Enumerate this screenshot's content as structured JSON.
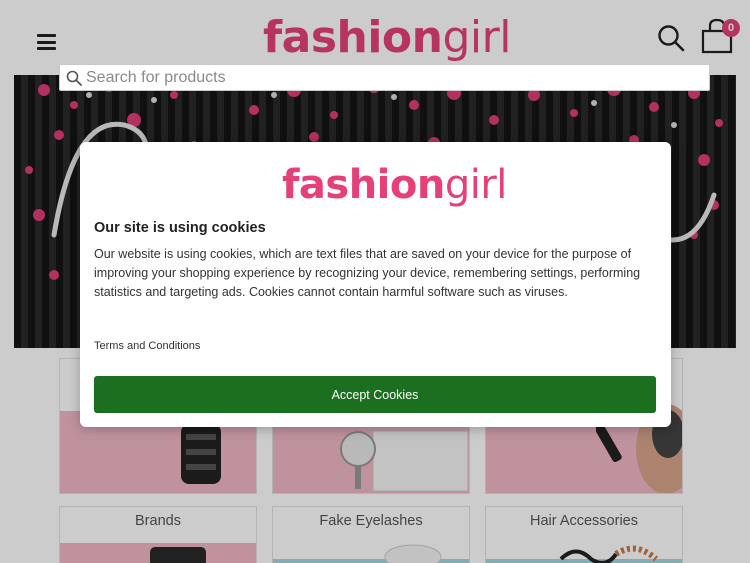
{
  "header": {
    "logo_part1": "fashion",
    "logo_part2": "girl",
    "menu_icon": "hamburger-menu-icon",
    "search_icon": "search-icon",
    "cart_icon": "shopping-bag-icon",
    "cart_count": "0"
  },
  "search": {
    "placeholder": "Search for products"
  },
  "categories": [
    {
      "label": "",
      "bg": "#f1b7c6"
    },
    {
      "label": "",
      "bg": "#f1b7c6"
    },
    {
      "label": "",
      "bg": "#f1b7c6"
    },
    {
      "label": "Brands",
      "bg": "#f1b7c6"
    },
    {
      "label": "Fake Eyelashes",
      "bg": "#a9d6df"
    },
    {
      "label": "Hair Accessories",
      "bg": "#a9d6df"
    }
  ],
  "cookie_modal": {
    "logo_part1": "fashion",
    "logo_part2": "girl",
    "title": "Our site is using cookies",
    "text": "Our website is using cookies, which are text files that are saved on your device for the purpose of improving your shopping experience by recognizing your device, remembering settings, performing statistics and targeting ads. Cookies cannot contain harmful software such as viruses.",
    "terms_link": "Terms and Conditions",
    "accept_label": "Accept Cookies",
    "accept_color": "#1b6f1e"
  },
  "colors": {
    "brand_pink": "#e5407a"
  }
}
